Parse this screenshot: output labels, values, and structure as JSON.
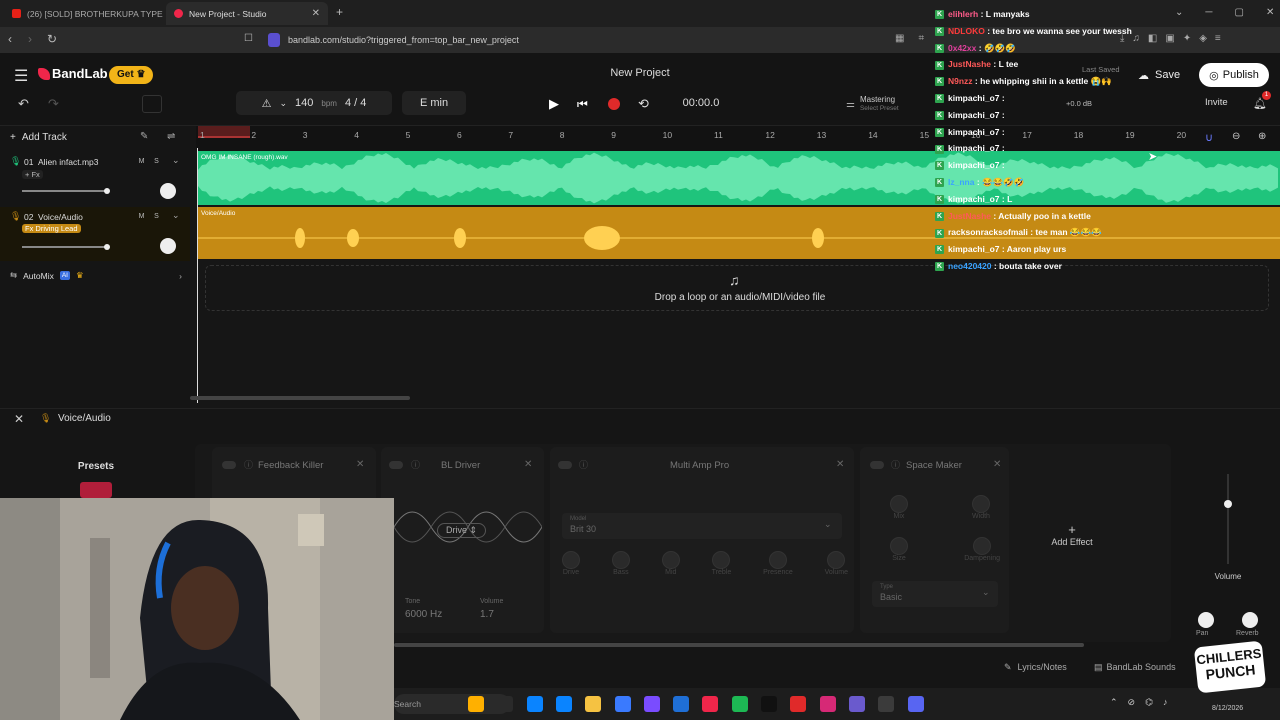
{
  "browser": {
    "tabs": [
      {
        "label": "(26) [SOLD] BROTHERKUPA TYPE BEAT"
      },
      {
        "label": "New Project - Studio"
      }
    ],
    "new_tab": "+",
    "url": "bandlab.com/studio?triggered_from=top_bar_new_project"
  },
  "app": {
    "brand": "BandLab",
    "get_label": "Get",
    "project_title": "New Project",
    "last_saved": "Last Saved",
    "save_label": "Save",
    "publish_label": "Publish",
    "invite_label": "Invite",
    "notif_count": "1"
  },
  "toolbar": {
    "bpm_value": "140",
    "bpm_unit": "bpm",
    "time_sig": "4 / 4",
    "key": "E min",
    "time": "00:00.0",
    "mastering": "Mastering",
    "select_preset": "Select Preset",
    "db": "+0.0 dB",
    "add_track": "Add Track"
  },
  "ruler": [
    "1",
    "2",
    "3",
    "4",
    "5",
    "6",
    "7",
    "8",
    "9",
    "10",
    "11",
    "12",
    "13",
    "14",
    "15",
    "16",
    "17",
    "18",
    "19",
    "20"
  ],
  "tracks": [
    {
      "index": "01",
      "name": "Alien infact.mp3",
      "fx": "+ Fx",
      "clip": "OMG IM INSANE (rough).wav",
      "color": "#1fc47c"
    },
    {
      "index": "02",
      "name": "Voice/Audio",
      "fx": "Fx Driving Lead",
      "clip": "Voice/Audio",
      "color": "#c58a14"
    }
  ],
  "automix": {
    "label": "AutoMix",
    "badge": "AI"
  },
  "mute_label": "M",
  "solo_label": "S",
  "dropzone_text": "Drop a loop or an audio/MIDI/video file",
  "fx": {
    "panel_title": "Voice/Audio",
    "presets_label": "Presets",
    "cards": [
      {
        "title": "Feedback Killer"
      },
      {
        "title": "BL Driver",
        "drive": "Drive",
        "tone_label": "Tone",
        "tone_value": "6000 Hz",
        "volume_label": "Volume",
        "volume_value": "1.7"
      },
      {
        "title": "Multi Amp Pro",
        "model_label": "Model",
        "model_value": "Brit 30",
        "knobs": [
          "Drive",
          "Bass",
          "Mid",
          "Treble",
          "Presence",
          "Volume"
        ]
      },
      {
        "title": "Space Maker",
        "knobs": [
          "Mix",
          "Width",
          "Size",
          "Dampening"
        ],
        "type_label": "Type",
        "type_value": "Basic"
      }
    ],
    "add_effect": "Add Effect",
    "volume_label": "Volume",
    "pan_label": "Pan",
    "reverb_label": "Reverb",
    "lyrics_label": "Lyrics/Notes",
    "sounds_label": "BandLab Sounds"
  },
  "chat": [
    {
      "user": "elihlerh",
      "msg": "L manyaks",
      "color": "#ff5b8a"
    },
    {
      "user": "NDLOKO",
      "msg": "tee bro we wanna see your twessh",
      "color": "#ff3b3b"
    },
    {
      "user": "0x42xx",
      "msg": "🤣🤣🤣",
      "color": "#e0409c"
    },
    {
      "user": "JustNashe",
      "msg": "L tee",
      "color": "#ff5959"
    },
    {
      "user": "N9nzz",
      "msg": "he whipping shii in a kettle 😭🙌",
      "color": "#ff5959"
    },
    {
      "user": "kimpachi_o7",
      "msg": "",
      "color": "#ffffff"
    },
    {
      "user": "kimpachi_o7",
      "msg": "",
      "color": "#ffffff"
    },
    {
      "user": "kimpachi_o7",
      "msg": "",
      "color": "#ffffff"
    },
    {
      "user": "kimpachi_o7",
      "msg": "",
      "color": "#ffffff"
    },
    {
      "user": "kimpachi_o7",
      "msg": "",
      "color": "#ffffff"
    },
    {
      "user": "lz_nna",
      "msg": "😂😂🤣🤣",
      "color": "#3aa3ff"
    },
    {
      "user": "kimpachi_o7",
      "msg": "L",
      "color": "#ffffff"
    },
    {
      "user": "JustNashe",
      "msg": "Actually poo in a kettle",
      "color": "#ff5959"
    },
    {
      "user": "racksonracksofmali",
      "msg": "tee man 😂😂😂",
      "color": "#ffffff"
    },
    {
      "user": "kimpachi_o7",
      "msg": "Aaron play urs",
      "color": "#ffffff"
    },
    {
      "user": "neo420420",
      "msg": "bouta take over",
      "color": "#3aa3ff"
    }
  ],
  "stream": {
    "logo_line1": "CHILLERS",
    "logo_line2": "PUNCH"
  },
  "taskbar": {
    "search": "Search",
    "date": "8/12/2026"
  },
  "colors": {
    "accent_green": "#1fc47c",
    "accent_orange": "#c58a14",
    "brand_red": "#f0264a",
    "get_yellow": "#f2b418"
  }
}
